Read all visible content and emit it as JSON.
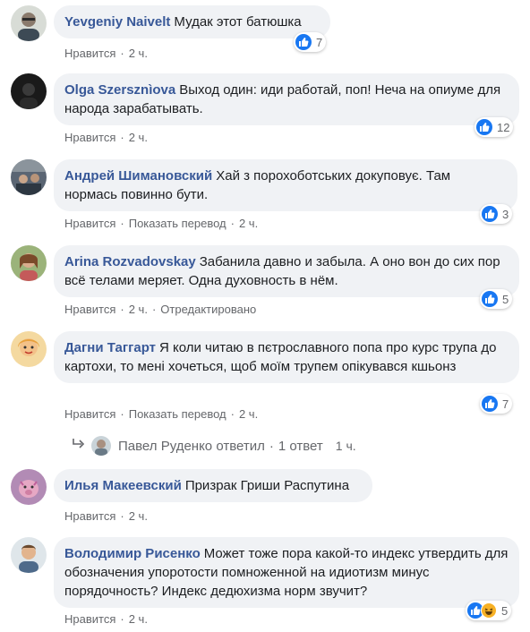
{
  "labels": {
    "like": "Нравится",
    "translate": "Показать перевод",
    "edited": "Отредактировано"
  },
  "comments": [
    {
      "author": "Yevgeniy Naivelt",
      "text": "Мудак этот батюшка",
      "time": "2 ч.",
      "reactions": "7"
    },
    {
      "author": "Olga Szersznìova",
      "text": "Выход один: иди работай, поп! Неча на опиуме для народа зарабатывать.",
      "time": "2 ч.",
      "reactions": "12"
    },
    {
      "author": "Андрей Шимановский",
      "text": "Хай з порохоботських докуповує. Там нормась повинно бути.",
      "time": "2 ч.",
      "reactions": "3"
    },
    {
      "author": "Arina Rozvadovskay",
      "text": "Забанила давно и забыла. А оно вон до сих пор всё телами меряет. Одна духовность в нём.",
      "time": "2 ч.",
      "reactions": "5"
    },
    {
      "author": "Дагни Таггарт",
      "text": "Я коли читаю в пєтрославного попа про курс трупа до картохи, то мені хочеться, щоб моїм трупем опікувався кшьонз",
      "time": "2 ч.",
      "reactions": "7"
    },
    {
      "author": "Илья Макеевский",
      "text": "Призрак Гриши Распутина",
      "time": "2 ч."
    },
    {
      "author": "Володимир Рисенко",
      "text": "Может тоже пора какой-то индекс утвердить для обозначения упоротости помноженной на идиотизм минус порядочность? Индекс дедюхизма норм звучит?",
      "time": "2 ч.",
      "reactions": "5"
    }
  ],
  "reply": {
    "name": "Павел Руденко ответил",
    "count": "1 ответ",
    "time": "1 ч."
  },
  "colors": {
    "author": "#385898",
    "bubble": "#f0f2f5",
    "like": "#1877f2",
    "haha": "#f7b125"
  }
}
